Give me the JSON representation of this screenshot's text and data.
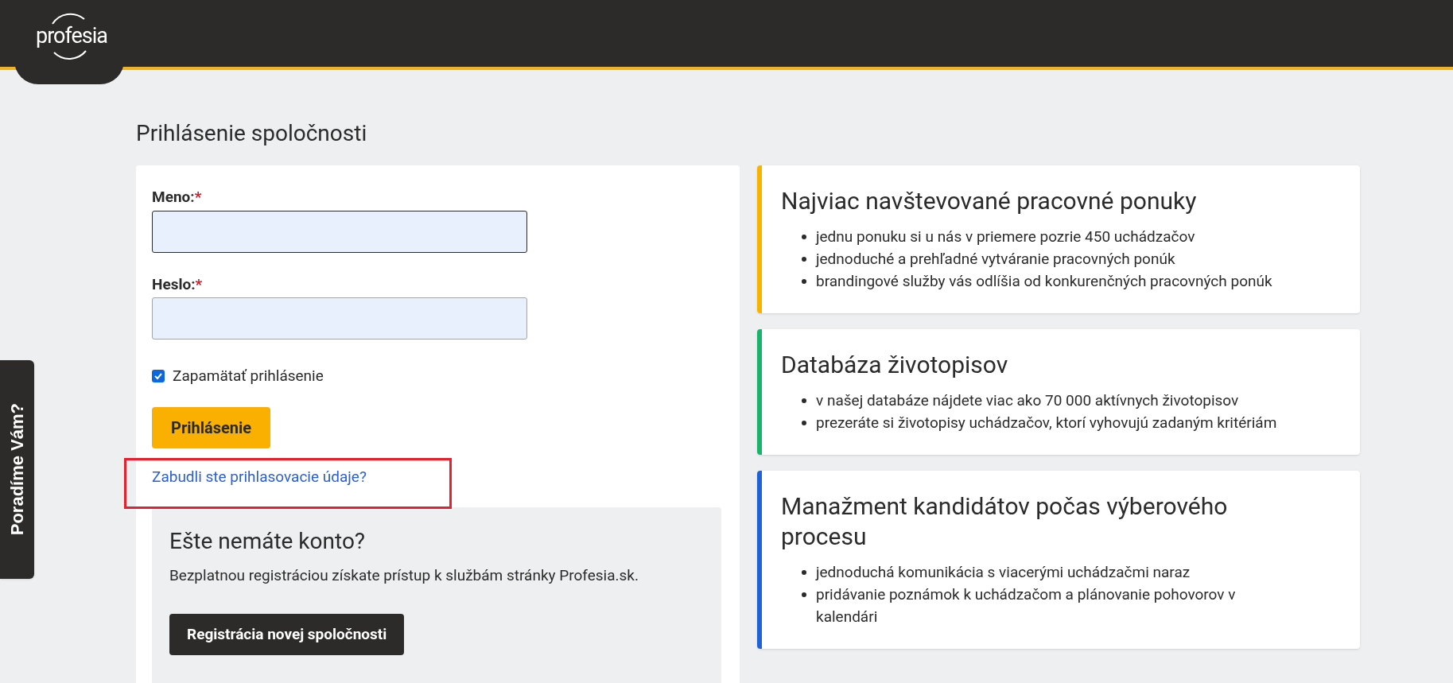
{
  "header": {
    "logo": "profesia"
  },
  "side_tab": {
    "label": "Poradíme Vám?"
  },
  "page_title": "Prihlásenie spoločnosti",
  "login_form": {
    "fields": [
      {
        "label": "Meno:",
        "required_mark": "*",
        "focused": true
      },
      {
        "label": "Heslo:",
        "required_mark": "*",
        "focused": false
      }
    ],
    "remember": {
      "label": "Zapamätať prihlásenie",
      "checked": true
    },
    "submit": "Prihlásenie",
    "forgot_link": {
      "text": "Zabudli ste prihlasovacie údaje?",
      "highlighted": true
    },
    "register_box": {
      "title": "Ešte nemáte konto?",
      "text": "Bezplatnou registráciou získate prístup k službám stránky Profesia.sk.",
      "button": "Registrácia novej spoločnosti"
    }
  },
  "features": [
    {
      "title": "Najviac navštevované pracovné ponuky",
      "color": "#f8b200",
      "items": [
        "jednu ponuku si u nás v priemere pozrie 450 uchádzačov",
        "jednoduché a prehľadné vytváranie pracovných ponúk",
        "brandingové služby vás odlíšia od konkurenčných pracovných ponúk"
      ]
    },
    {
      "title": "Databáza životopisov",
      "color": "#1ab36b",
      "items": [
        "v našej databáze nájdete viac ako 70 000 aktívnych životopisov",
        "prezeráte si životopisy uchádzačov, ktorí vyhovujú zadaným kritériám"
      ]
    },
    {
      "title": "Manažment kandidátov počas výberového procesu",
      "color": "#1f62d6",
      "items": [
        "jednoduchá komunikácia s viacerými uchádzačmi naraz",
        "pridávanie poznámok k uchádzačom a plánovanie pohovorov v kalendári"
      ]
    }
  ]
}
